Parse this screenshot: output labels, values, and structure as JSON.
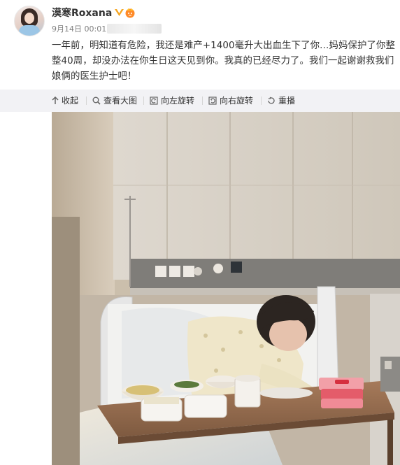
{
  "post": {
    "username": "漠寒Roxana",
    "date": "9月14日 00:01",
    "text": "一年前，明知道有危险，我还是难产+1400毫升大出血生下了你…妈妈保护了你整整40周，却没办法在你生日这天见到你。我真的已经尽力了。我们一起谢谢救我们娘俩的医生护士吧！"
  },
  "icons": {
    "verified": "verified-badge-icon",
    "vip": "vip-crown-icon"
  },
  "toolbar": {
    "collapse": "收起",
    "view_large": "查看大图",
    "rotate_left": "向左旋转",
    "rotate_right": "向右旋转",
    "replay": "重播"
  },
  "colors": {
    "toolbar_bg": "#f2f2f5",
    "verified": "#f5a623",
    "text": "#333333",
    "meta": "#808080"
  }
}
